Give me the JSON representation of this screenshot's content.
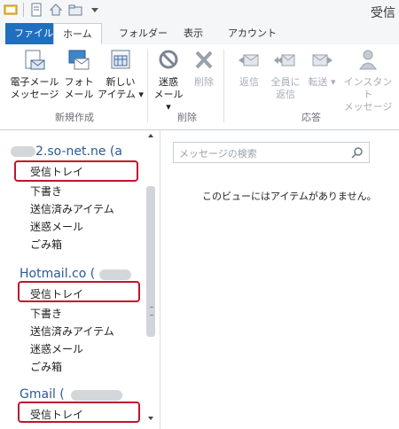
{
  "window": {
    "title": "受信"
  },
  "tabs": [
    "ファイル",
    "ホーム",
    "フォルダー",
    "表示",
    "アカウント"
  ],
  "ribbon": {
    "new_group": {
      "label": "新規作成",
      "email": [
        "電子メール",
        "メッセージ"
      ],
      "photo": [
        "フォト",
        "メール"
      ],
      "new_items": [
        "新しい",
        "アイテム ▾"
      ]
    },
    "delete_group": {
      "label": "削除",
      "junk": [
        "迷惑",
        "メール ▾"
      ],
      "delete": "削除"
    },
    "respond_group": {
      "label": "応答",
      "reply": "返信",
      "reply_all": [
        "全員に",
        "返信"
      ],
      "forward": "転送 ▾",
      "instant": [
        "インスタント",
        "メッセージ"
      ]
    }
  },
  "accounts": [
    {
      "name": "2.so-net.ne (a",
      "folders": [
        "受信トレイ",
        "下書き",
        "送信済みアイテム",
        "迷惑メール",
        "ごみ箱"
      ]
    },
    {
      "name": "Hotmail.co (",
      "folders": [
        "受信トレイ",
        "下書き",
        "送信済みアイテム",
        "迷惑メール",
        "ごみ箱"
      ]
    },
    {
      "name": "Gmail (",
      "folders": [
        "受信トレイ"
      ]
    }
  ],
  "search": {
    "placeholder": "メッセージの検索"
  },
  "message_list": {
    "empty_text": "このビューにはアイテムがありません。"
  },
  "colors": {
    "file_tab": "#1f6fc0",
    "highlight": "#c0142e",
    "account": "#2a5a98"
  },
  "icons": [
    "app-icon",
    "new-icon",
    "home-icon",
    "folder-icon",
    "search-icon"
  ]
}
